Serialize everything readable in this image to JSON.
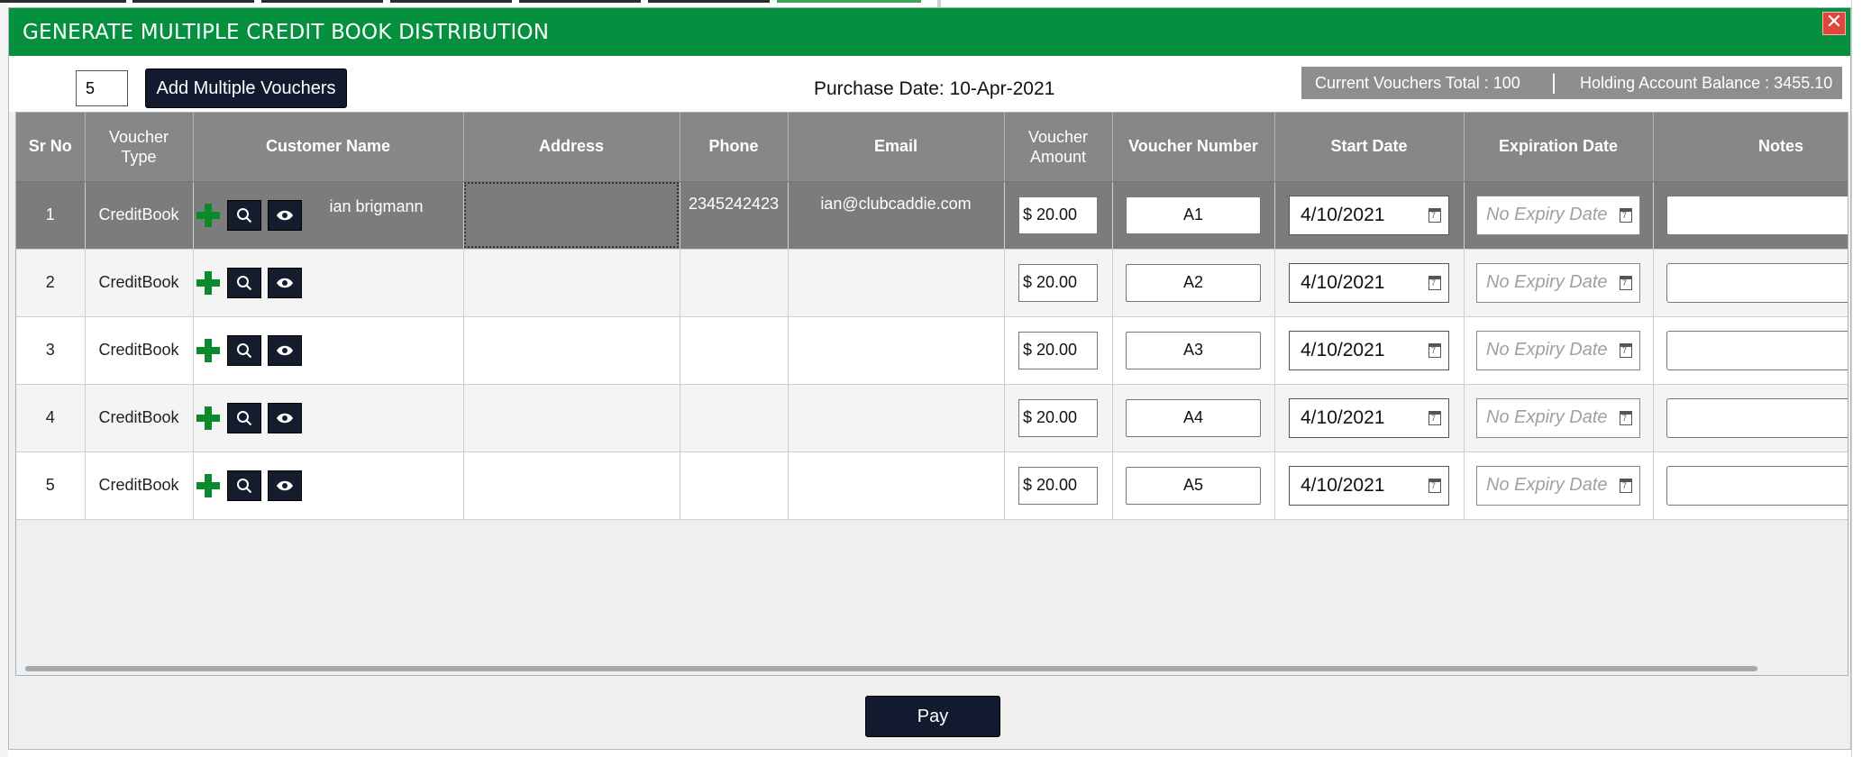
{
  "window": {
    "title": "GENERATE MULTIPLE CREDIT BOOK DISTRIBUTION",
    "close_glyph": "✕"
  },
  "toolbar": {
    "voucher_count": "5",
    "add_label": "Add Multiple Vouchers",
    "purchase_date": "Purchase Date: 10-Apr-2021",
    "current_total": "Current Vouchers Total : 100",
    "separator": "|",
    "holding_balance": "Holding Account Balance : 3455.10"
  },
  "table": {
    "headers": {
      "sr_no": "Sr No",
      "voucher_type_1": "Voucher",
      "voucher_type_2": "Type",
      "customer_name": "Customer Name",
      "address": "Address",
      "phone": "Phone",
      "email": "Email",
      "voucher_amount_1": "Voucher",
      "voucher_amount_2": "Amount",
      "voucher_number": "Voucher Number",
      "start_date": "Start Date",
      "expiration_date": "Expiration Date",
      "notes": "Notes"
    },
    "rows": [
      {
        "sr": "1",
        "type": "CreditBook",
        "customer": "ian brigmann",
        "address": "",
        "phone": "2345242423",
        "email": "ian@clubcaddie.com",
        "amount": "$ 20.00",
        "number": "A1",
        "start": "4/10/2021",
        "expiry_placeholder": "No Expiry Date",
        "notes": ""
      },
      {
        "sr": "2",
        "type": "CreditBook",
        "customer": "",
        "address": "",
        "phone": "",
        "email": "",
        "amount": "$ 20.00",
        "number": "A2",
        "start": "4/10/2021",
        "expiry_placeholder": "No Expiry Date",
        "notes": ""
      },
      {
        "sr": "3",
        "type": "CreditBook",
        "customer": "",
        "address": "",
        "phone": "",
        "email": "",
        "amount": "$ 20.00",
        "number": "A3",
        "start": "4/10/2021",
        "expiry_placeholder": "No Expiry Date",
        "notes": ""
      },
      {
        "sr": "4",
        "type": "CreditBook",
        "customer": "",
        "address": "",
        "phone": "",
        "email": "",
        "amount": "$ 20.00",
        "number": "A4",
        "start": "4/10/2021",
        "expiry_placeholder": "No Expiry Date",
        "notes": ""
      },
      {
        "sr": "5",
        "type": "CreditBook",
        "customer": "",
        "address": "",
        "phone": "",
        "email": "",
        "amount": "$ 20.00",
        "number": "A5",
        "start": "4/10/2021",
        "expiry_placeholder": "No Expiry Date",
        "notes": ""
      }
    ]
  },
  "footer": {
    "pay_label": "Pay"
  },
  "colors": {
    "title_bar": "#04903f",
    "header_bg": "#878787",
    "selected_row": "#7c7c7c",
    "dark_button": "#111a2e",
    "add_icon": "#0a8a2a",
    "close_button": "#e0463c"
  },
  "icons": {
    "add": "plus-icon",
    "search": "search-icon",
    "view": "eye-icon",
    "calendar": "calendar-icon",
    "close": "close-icon"
  }
}
